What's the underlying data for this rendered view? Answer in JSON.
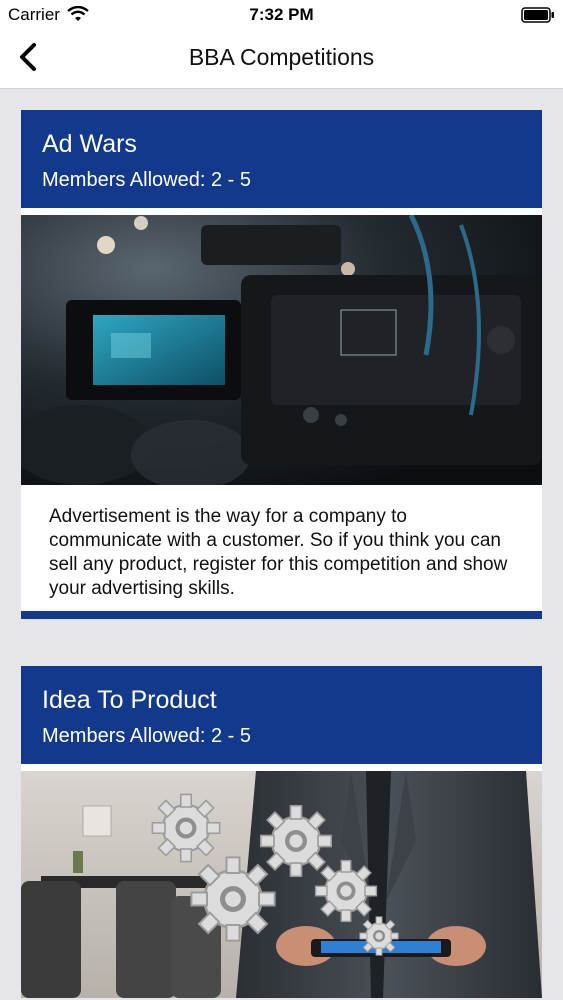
{
  "status": {
    "carrier": "Carrier",
    "time": "7:32 PM"
  },
  "nav": {
    "title": "BBA Competitions",
    "back_icon": "chevron-left-icon"
  },
  "competitions": [
    {
      "title": "Ad Wars",
      "members": "Members Allowed: 2 - 5",
      "image": "video-camera-photo",
      "description": "Advertisement is the way for a company to communicate with a customer. So if you think you can sell any product, register for this competition and show your advertising skills."
    },
    {
      "title": "Idea To Product",
      "members": "Members Allowed: 2 - 5",
      "image": "gears-tablet-photo"
    }
  ],
  "colors": {
    "accent": "#12398b",
    "background": "#e6e6ea"
  }
}
